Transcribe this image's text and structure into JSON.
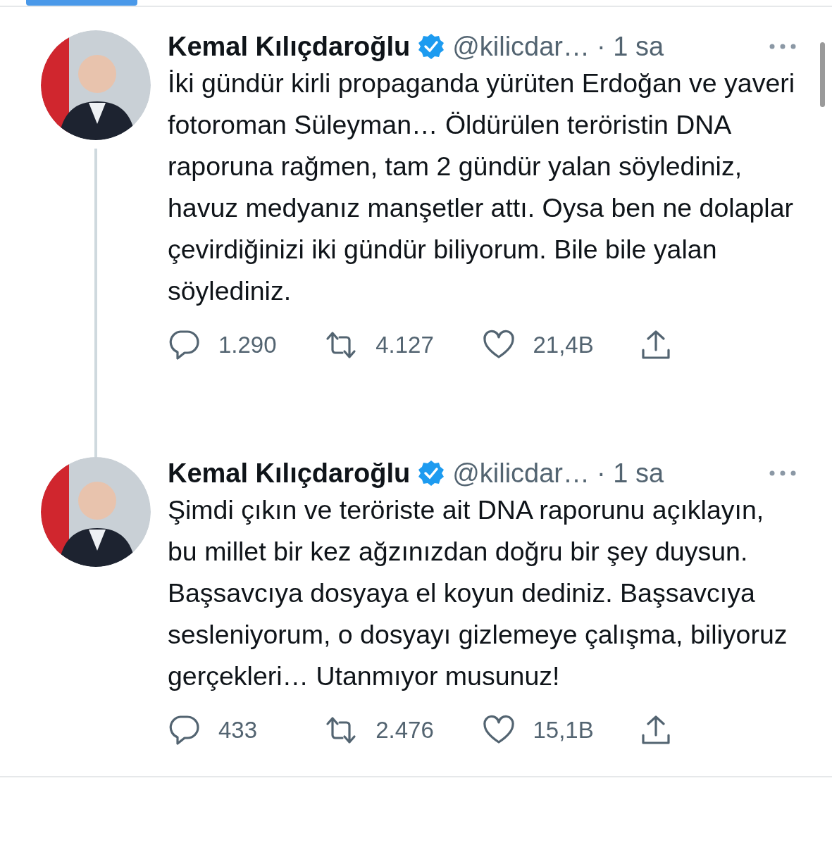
{
  "tweets": [
    {
      "name": "Kemal Kılıçdaroğlu",
      "verified": true,
      "handle": "@kilicdar…",
      "time": "· 1 sa",
      "text": "İki gündür kirli propaganda yürüten Erdoğan ve yaveri fotoroman Süleyman… Öldürülen teröristin DNA raporuna rağmen, tam 2 gündür yalan söylediniz, havuz medyanız manşetler attı. Oysa ben ne dolaplar çevirdiğinizi iki gündür biliyorum. Bile bile yalan söylediniz.",
      "thread_line": true,
      "replies": "1.290",
      "retweets": "4.127",
      "likes": "21,4B"
    },
    {
      "name": "Kemal Kılıçdaroğlu",
      "verified": true,
      "handle": "@kilicdar…",
      "time": "· 1 sa",
      "text": "Şimdi çıkın ve teröriste ait DNA raporunu açıklayın, bu millet bir kez ağzınızdan doğru bir şey duysun. Başsavcıya dosyaya el koyun dediniz. Başsavcıya sesleniyorum, o dosyayı gizlemeye çalışma, biliyoruz gerçekleri… Utanmıyor musunuz!",
      "thread_line": false,
      "replies": "433",
      "retweets": "2.476",
      "likes": "15,1B"
    }
  ]
}
